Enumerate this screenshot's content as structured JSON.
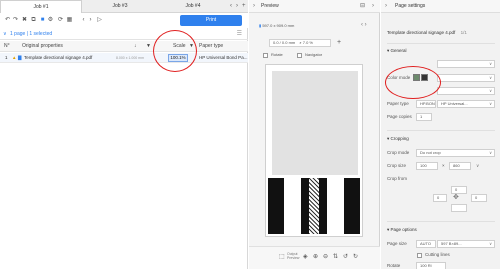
{
  "tabs": [
    {
      "label": "Job #1"
    },
    {
      "label": "Job #3"
    },
    {
      "label": "Job #4"
    }
  ],
  "toolbar": {
    "print_label": "Print"
  },
  "page_info": {
    "text": "1 page | 1 selected"
  },
  "table": {
    "columns": [
      "N°",
      "Original properties",
      "Scale",
      "Paper type"
    ],
    "rows": [
      {
        "number": "1",
        "name": "Template directional signage 4.pdf",
        "size": "8.000 x 1.000 mm",
        "scale": "100.1%",
        "paper": "HP Universal Bond Pa..."
      }
    ]
  },
  "preview": {
    "title": "Preview",
    "page_line": "597.0 x 909.0 mm",
    "zoom_field": "0.0 / 0.0 mm",
    "zoom_value": "7.0 %",
    "checkbox_rotate": "Rotate",
    "checkbox_navigator": "Navigator",
    "footer_label": "Output Preview"
  },
  "settings": {
    "title": "Page settings",
    "filename": "Template directional signage 4.pdf",
    "page_of": "1/1",
    "general_label": "General",
    "color_mode_label": "Color mode",
    "paper_type_label": "Paper type",
    "paper_type_badge": "HP.BOND",
    "paper_type_value": "HP Universal...",
    "page_copies_label": "Page copies",
    "page_copies_value": "1",
    "cropping_label": "Cropping",
    "crop_mode_label": "Crop mode",
    "crop_mode_value": "Do not crop",
    "crop_size_label": "Crop size",
    "crop_size_w": "100",
    "crop_size_h": "860",
    "crop_from_label": "Crop from",
    "crop_from_a": "0",
    "crop_from_b": "0",
    "crop_from_c": "0",
    "page_options_label": "Page options",
    "page_size_label": "Page size",
    "page_size_mode": "AUTO",
    "page_size_value": "597 B×89...",
    "cutting_label": "Cutting lines",
    "rotate_label": "Rotate",
    "rotate_value": "100 Rl"
  },
  "colors": {
    "accent": "#2f80ed",
    "annotation": "#e02020"
  }
}
